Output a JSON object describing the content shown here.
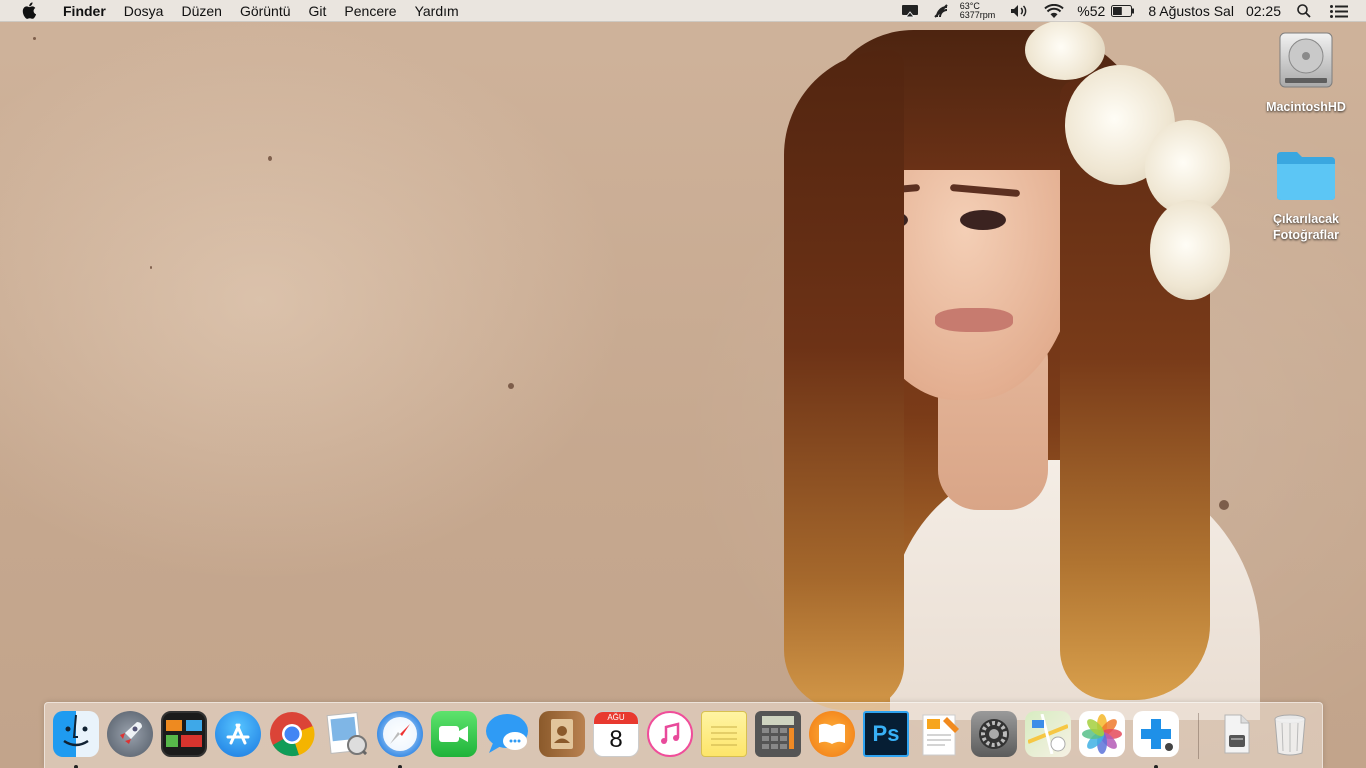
{
  "menubar": {
    "app_name": "Finder",
    "menus": [
      "Dosya",
      "Düzen",
      "Görüntü",
      "Git",
      "Pencere",
      "Yardım"
    ],
    "temperature": "63°C",
    "fan_speed": "6377rpm",
    "battery_percent": "%52",
    "battery_level": 0.52,
    "date": "8 Ağustos Sal",
    "time": "02:25"
  },
  "desktop_icons": [
    {
      "label": "MacintoshHD",
      "icon": "hard-drive-icon"
    },
    {
      "label": "Çıkarılacak Fotoğraflar",
      "icon": "folder-icon"
    }
  ],
  "dock": {
    "apps": [
      {
        "name": "Finder",
        "icon": "finder-icon",
        "running": true
      },
      {
        "name": "Launchpad",
        "icon": "launchpad-icon",
        "running": false
      },
      {
        "name": "Mission Control",
        "icon": "mission-control-icon",
        "running": false
      },
      {
        "name": "App Store",
        "icon": "app-store-icon",
        "running": false
      },
      {
        "name": "Google Chrome",
        "icon": "chrome-icon",
        "running": false
      },
      {
        "name": "Preview",
        "icon": "preview-icon",
        "running": false
      },
      {
        "name": "Safari",
        "icon": "safari-icon",
        "running": true
      },
      {
        "name": "FaceTime",
        "icon": "facetime-icon",
        "running": false
      },
      {
        "name": "Messages",
        "icon": "messages-icon",
        "running": false
      },
      {
        "name": "Contacts",
        "icon": "contacts-icon",
        "running": false
      },
      {
        "name": "Calendar",
        "icon": "calendar-icon",
        "running": false,
        "month": "AĞU",
        "day": "8"
      },
      {
        "name": "iTunes",
        "icon": "itunes-icon",
        "running": false
      },
      {
        "name": "Notes",
        "icon": "notes-icon",
        "running": false
      },
      {
        "name": "Calculator",
        "icon": "calculator-icon",
        "running": false
      },
      {
        "name": "iBooks",
        "icon": "ibooks-icon",
        "running": false
      },
      {
        "name": "Photoshop",
        "icon": "photoshop-icon",
        "running": false,
        "glyph": "Ps"
      },
      {
        "name": "Pages",
        "icon": "pages-icon",
        "running": false
      },
      {
        "name": "System Preferences",
        "icon": "system-preferences-icon",
        "running": false
      },
      {
        "name": "Maps",
        "icon": "maps-icon",
        "running": false
      },
      {
        "name": "Photos",
        "icon": "photos-icon",
        "running": false
      },
      {
        "name": "Plus App",
        "icon": "plus-app-icon",
        "running": true
      }
    ],
    "extras": [
      {
        "name": "Downloads",
        "icon": "downloads-stack-icon"
      },
      {
        "name": "Trash",
        "icon": "trash-icon"
      }
    ]
  }
}
